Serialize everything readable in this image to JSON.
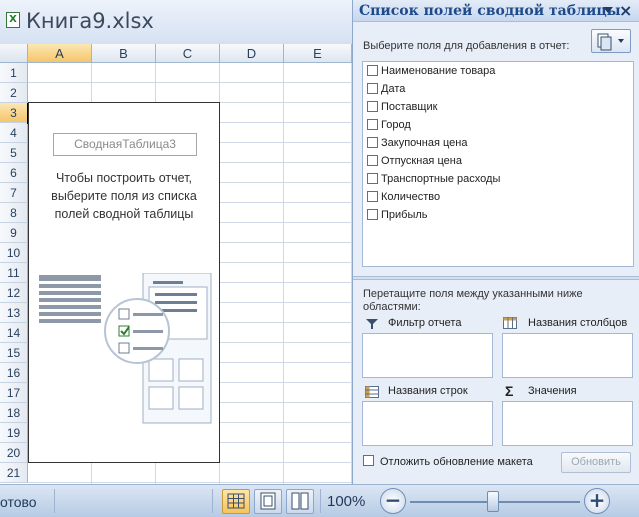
{
  "window": {
    "title": "Книга9.xlsx",
    "app_icon": "excel-file-icon"
  },
  "sheet": {
    "columns": [
      "A",
      "B",
      "C",
      "D",
      "E"
    ],
    "selected_column": "A",
    "rows": [
      "1",
      "2",
      "3",
      "4",
      "5",
      "6",
      "7",
      "8",
      "9",
      "10",
      "11",
      "12",
      "13",
      "14",
      "15",
      "16",
      "17",
      "18",
      "19",
      "20",
      "21"
    ],
    "selected_row": "3"
  },
  "pivot_placeholder": {
    "name": "СводнаяТаблица3",
    "message": "Чтобы построить отчет, выберите поля из списка полей сводной таблицы"
  },
  "status_bar": {
    "status_text": "отово",
    "zoom": "100%",
    "zoom_out": "−",
    "zoom_in": "+"
  },
  "field_list": {
    "title": "Список полей сводной таблицы",
    "pick_label": "Выберите поля для добавления в отчет:",
    "fields": [
      {
        "label": "Наименование товара",
        "checked": false
      },
      {
        "label": "Дата",
        "checked": false
      },
      {
        "label": "Поставщик",
        "checked": false
      },
      {
        "label": "Город",
        "checked": false
      },
      {
        "label": "Закупочная цена",
        "checked": false
      },
      {
        "label": "Отпускная цена",
        "checked": false
      },
      {
        "label": "Транспортные расходы",
        "checked": false
      },
      {
        "label": "Количество",
        "checked": false
      },
      {
        "label": "Прибыль",
        "checked": false
      }
    ],
    "drag_label": "Перетащите поля между указанными ниже областями:",
    "areas": {
      "filter": "Фильтр отчета",
      "columns": "Названия столбцов",
      "rows": "Названия строк",
      "values": "Значения"
    },
    "defer_label": "Отложить обновление макета",
    "update_button": "Обновить"
  },
  "colors": {
    "accent": "#1e4a8a",
    "selection": "#f5c56b",
    "grid": "#d0d7e5"
  }
}
